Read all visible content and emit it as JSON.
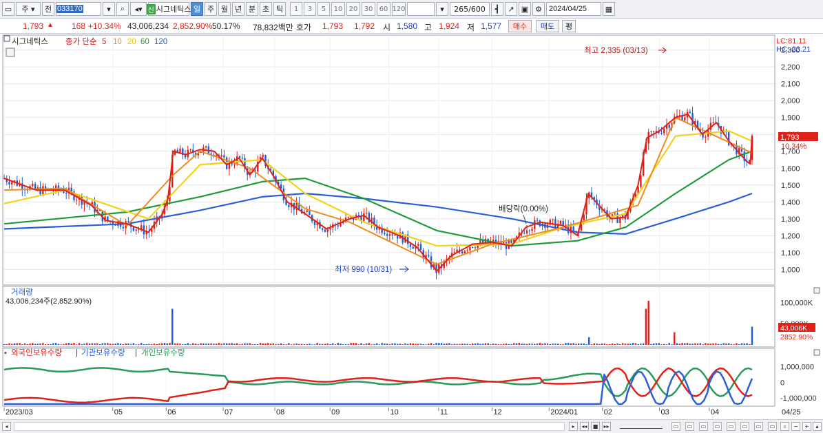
{
  "toolbar": {
    "market": "주",
    "prev": "전",
    "code": "033170",
    "new_badge": "신",
    "stock_name": "시그네틱스",
    "periods": [
      "일",
      "주",
      "월",
      "년",
      "분",
      "초",
      "틱"
    ],
    "active_period": "일",
    "intervals": [
      "1",
      "3",
      "5",
      "10",
      "20",
      "30",
      "60",
      "120"
    ],
    "count": "265",
    "total": "/600",
    "date": "2024/04/25"
  },
  "quote": {
    "price": "1,793",
    "change": "168",
    "change_pct": "+10.34%",
    "volume": "43,006,234",
    "volume_ratio": "2,852.90%",
    "turnover_pct": "50.17%",
    "amount": "78,832백만",
    "hoga_label": "호가",
    "ask": "1,793",
    "bid": "1,792",
    "open_label": "시",
    "open": "1,580",
    "high_label": "고",
    "high": "1,924",
    "low_label": "저",
    "low": "1,577",
    "buy_label": "매수",
    "sell_label": "매도",
    "avg_label": "평"
  },
  "chart": {
    "legend_name": "시그네틱스",
    "legend_ma": "종가 단순",
    "ma_periods": [
      "5",
      "10",
      "20",
      "60",
      "120"
    ],
    "lc": "LC:81.11",
    "hc": "HC:-23.21",
    "high_annotation": "최고 2,335 (03/13)",
    "low_annotation": "최저 990 (10/31)",
    "dividend_annotation": "배당락(0.00%)",
    "price_box": "1,793",
    "pct_box": "10.34%",
    "volume_title": "거래량",
    "volume_info": "43,006,234주(2,852.90%)",
    "volume_box": "43,006K",
    "volume_pct_box": "2852.90%",
    "foreign_label": "외국인보유수량",
    "inst_label": "기관보유수량",
    "indiv_label": "개인보유수량",
    "x_ticks": [
      "2023/03",
      "05",
      "06",
      "07",
      "08",
      "09",
      "10",
      "11",
      "12",
      "2024/01",
      "02",
      "03",
      "04",
      "04/25"
    ]
  },
  "chart_data": {
    "type": "candlestick",
    "symbol": "시그네틱스",
    "y_ticks": [
      1000,
      1100,
      1200,
      1300,
      1400,
      1500,
      1600,
      1700,
      1800,
      1900,
      2000,
      2100,
      2200,
      2300
    ],
    "y_tick_labels": [
      "1,000",
      "1,100",
      "1,200",
      "1,300",
      "1,400",
      "1,500",
      "1,600",
      "1,700",
      "1,800",
      "1,900",
      "2,000",
      "2,100",
      "2,200",
      "2,300"
    ],
    "ylim": [
      920,
      2380
    ],
    "close_path": [
      {
        "x": "2023-03-02",
        "y": 1540
      },
      {
        "x": "2023-03-20",
        "y": 1470
      },
      {
        "x": "2023-04-05",
        "y": 1470
      },
      {
        "x": "2023-04-20",
        "y": 1380
      },
      {
        "x": "2023-04-28",
        "y": 1290
      },
      {
        "x": "2023-05-10",
        "y": 1270
      },
      {
        "x": "2023-05-22",
        "y": 1220
      },
      {
        "x": "2023-05-30",
        "y": 1330
      },
      {
        "x": "2023-06-02",
        "y": 1420
      },
      {
        "x": "2023-06-05",
        "y": 1700
      },
      {
        "x": "2023-06-12",
        "y": 1680
      },
      {
        "x": "2023-06-20",
        "y": 1710
      },
      {
        "x": "2023-06-28",
        "y": 1700
      },
      {
        "x": "2023-07-05",
        "y": 1620
      },
      {
        "x": "2023-07-12",
        "y": 1660
      },
      {
        "x": "2023-07-18",
        "y": 1560
      },
      {
        "x": "2023-07-25",
        "y": 1660
      },
      {
        "x": "2023-08-01",
        "y": 1540
      },
      {
        "x": "2023-08-08",
        "y": 1400
      },
      {
        "x": "2023-08-18",
        "y": 1330
      },
      {
        "x": "2023-08-30",
        "y": 1240
      },
      {
        "x": "2023-09-12",
        "y": 1300
      },
      {
        "x": "2023-09-20",
        "y": 1320
      },
      {
        "x": "2023-09-28",
        "y": 1250
      },
      {
        "x": "2023-10-10",
        "y": 1200
      },
      {
        "x": "2023-10-20",
        "y": 1130
      },
      {
        "x": "2023-10-31",
        "y": 990
      },
      {
        "x": "2023-11-08",
        "y": 1080
      },
      {
        "x": "2023-11-20",
        "y": 1150
      },
      {
        "x": "2023-12-01",
        "y": 1160
      },
      {
        "x": "2023-12-12",
        "y": 1140
      },
      {
        "x": "2023-12-20",
        "y": 1250
      },
      {
        "x": "2023-12-28",
        "y": 1280
      },
      {
        "x": "2024-01-10",
        "y": 1260
      },
      {
        "x": "2024-01-18",
        "y": 1200
      },
      {
        "x": "2024-01-24",
        "y": 1450
      },
      {
        "x": "2024-01-30",
        "y": 1380
      },
      {
        "x": "2024-02-06",
        "y": 1300
      },
      {
        "x": "2024-02-14",
        "y": 1310
      },
      {
        "x": "2024-02-21",
        "y": 1500
      },
      {
        "x": "2024-02-26",
        "y": 1780
      },
      {
        "x": "2024-03-04",
        "y": 1820
      },
      {
        "x": "2024-03-13",
        "y": 1900
      },
      {
        "x": "2024-03-20",
        "y": 1920
      },
      {
        "x": "2024-03-28",
        "y": 1800
      },
      {
        "x": "2024-04-05",
        "y": 1870
      },
      {
        "x": "2024-04-12",
        "y": 1760
      },
      {
        "x": "2024-04-22",
        "y": 1640
      },
      {
        "x": "2024-04-24",
        "y": 1625
      },
      {
        "x": "2024-04-25",
        "y": 1793
      }
    ],
    "ma5_approx": [
      {
        "x": "2023-03-02",
        "y": 1470
      },
      {
        "x": "2023-04-05",
        "y": 1480
      },
      {
        "x": "2023-05-10",
        "y": 1260
      },
      {
        "x": "2023-06-05",
        "y": 1560
      },
      {
        "x": "2023-06-20",
        "y": 1700
      },
      {
        "x": "2023-07-18",
        "y": 1600
      },
      {
        "x": "2023-08-18",
        "y": 1360
      },
      {
        "x": "2023-09-12",
        "y": 1280
      },
      {
        "x": "2023-10-31",
        "y": 1030
      },
      {
        "x": "2023-12-01",
        "y": 1150
      },
      {
        "x": "2024-01-10",
        "y": 1250
      },
      {
        "x": "2024-02-21",
        "y": 1380
      },
      {
        "x": "2024-03-13",
        "y": 1900
      },
      {
        "x": "2024-04-25",
        "y": 1690
      }
    ],
    "ma20_approx": [
      {
        "x": "2023-03-02",
        "y": 1390
      },
      {
        "x": "2023-04-05",
        "y": 1470
      },
      {
        "x": "2023-05-22",
        "y": 1300
      },
      {
        "x": "2023-06-20",
        "y": 1620
      },
      {
        "x": "2023-07-25",
        "y": 1650
      },
      {
        "x": "2023-08-18",
        "y": 1450
      },
      {
        "x": "2023-09-20",
        "y": 1280
      },
      {
        "x": "2023-10-31",
        "y": 1140
      },
      {
        "x": "2023-12-12",
        "y": 1150
      },
      {
        "x": "2024-01-10",
        "y": 1250
      },
      {
        "x": "2024-02-14",
        "y": 1330
      },
      {
        "x": "2024-03-13",
        "y": 1790
      },
      {
        "x": "2024-04-12",
        "y": 1820
      },
      {
        "x": "2024-04-25",
        "y": 1760
      }
    ],
    "ma60_approx": [
      {
        "x": "2023-03-02",
        "y": 1270
      },
      {
        "x": "2023-05-10",
        "y": 1340
      },
      {
        "x": "2023-06-20",
        "y": 1430
      },
      {
        "x": "2023-07-25",
        "y": 1520
      },
      {
        "x": "2023-08-18",
        "y": 1540
      },
      {
        "x": "2023-09-20",
        "y": 1420
      },
      {
        "x": "2023-10-31",
        "y": 1230
      },
      {
        "x": "2023-12-12",
        "y": 1140
      },
      {
        "x": "2024-01-18",
        "y": 1170
      },
      {
        "x": "2024-02-14",
        "y": 1250
      },
      {
        "x": "2024-03-13",
        "y": 1450
      },
      {
        "x": "2024-04-12",
        "y": 1650
      },
      {
        "x": "2024-04-25",
        "y": 1700
      }
    ],
    "ma120_approx": [
      {
        "x": "2023-03-02",
        "y": 1240
      },
      {
        "x": "2023-05-10",
        "y": 1270
      },
      {
        "x": "2023-06-20",
        "y": 1350
      },
      {
        "x": "2023-07-25",
        "y": 1430
      },
      {
        "x": "2023-08-18",
        "y": 1450
      },
      {
        "x": "2023-09-20",
        "y": 1420
      },
      {
        "x": "2023-10-31",
        "y": 1370
      },
      {
        "x": "2023-12-12",
        "y": 1300
      },
      {
        "x": "2024-01-18",
        "y": 1220
      },
      {
        "x": "2024-02-14",
        "y": 1210
      },
      {
        "x": "2024-03-13",
        "y": 1300
      },
      {
        "x": "2024-04-12",
        "y": 1400
      },
      {
        "x": "2024-04-25",
        "y": 1450
      }
    ],
    "volume": {
      "y_ticks": [
        50000,
        100000
      ],
      "y_tick_labels": [
        "50,000K",
        "100,000K"
      ],
      "unit": "K",
      "spikes": [
        {
          "x": "2023-06-05",
          "y": 85000
        },
        {
          "x": "2024-01-24",
          "y": 18000
        },
        {
          "x": "2024-02-26",
          "y": 85000
        },
        {
          "x": "2024-02-27",
          "y": 104000
        },
        {
          "x": "2024-03-13",
          "y": 30000
        },
        {
          "x": "2024-04-25",
          "y": 43006
        }
      ]
    },
    "holdings": {
      "y_ticks": [
        -1000000,
        0,
        1000000
      ],
      "y_tick_labels": [
        "-1,000,000",
        "0",
        "1,000,000"
      ],
      "series": [
        "외국인보유수량",
        "기관보유수량",
        "개인보유수량"
      ]
    }
  },
  "colors": {
    "up": "#e0211a",
    "down": "#1b5fd6",
    "ma5": "#e0211a",
    "ma10": "#f08c1e",
    "ma20": "#f2d21a",
    "ma60": "#1f9a3a",
    "ma120": "#2a5fd8",
    "foreign": "#e0211a",
    "inst": "#2a5fd8",
    "indiv": "#2a9a5a"
  }
}
